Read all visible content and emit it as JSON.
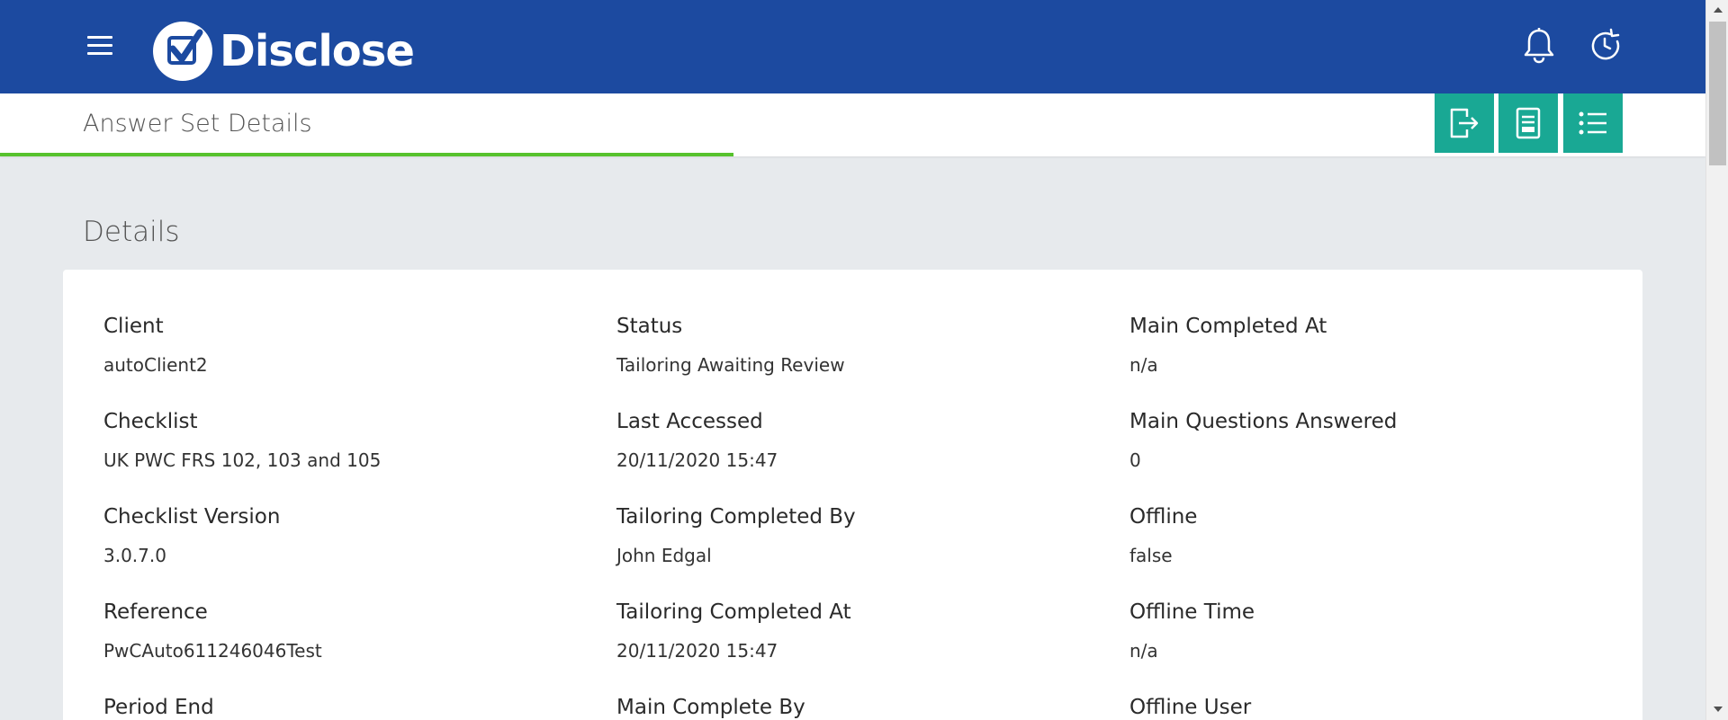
{
  "brand": {
    "name": "Disclose",
    "primary_color": "#1c4aa0",
    "accent_color": "#19a894",
    "progress_color": "#57c22d"
  },
  "header": {
    "icons": [
      "menu-icon",
      "bell-icon",
      "clock-refresh-icon"
    ]
  },
  "subheader": {
    "title": "Answer Set Details",
    "progress_fraction": 0.43,
    "actions": [
      "export-icon",
      "report-icon",
      "list-icon"
    ]
  },
  "section": {
    "title": "Details"
  },
  "details": {
    "columns": [
      [
        {
          "label": "Client",
          "value": "autoClient2"
        },
        {
          "label": "Checklist",
          "value": "UK PWC FRS 102, 103 and 105"
        },
        {
          "label": "Checklist Version",
          "value": "3.0.7.0"
        },
        {
          "label": "Reference",
          "value": "PwCAuto611246046Test"
        },
        {
          "label": "Period End",
          "value": ""
        }
      ],
      [
        {
          "label": "Status",
          "value": "Tailoring Awaiting Review"
        },
        {
          "label": "Last Accessed",
          "value": "20/11/2020 15:47"
        },
        {
          "label": "Tailoring Completed By",
          "value": "John Edgal"
        },
        {
          "label": "Tailoring Completed At",
          "value": "20/11/2020 15:47"
        },
        {
          "label": "Main Complete By",
          "value": ""
        }
      ],
      [
        {
          "label": "Main Completed At",
          "value": "n/a"
        },
        {
          "label": "Main Questions Answered",
          "value": "0"
        },
        {
          "label": "Offline",
          "value": "false"
        },
        {
          "label": "Offline Time",
          "value": "n/a"
        },
        {
          "label": "Offline User",
          "value": ""
        }
      ]
    ]
  }
}
